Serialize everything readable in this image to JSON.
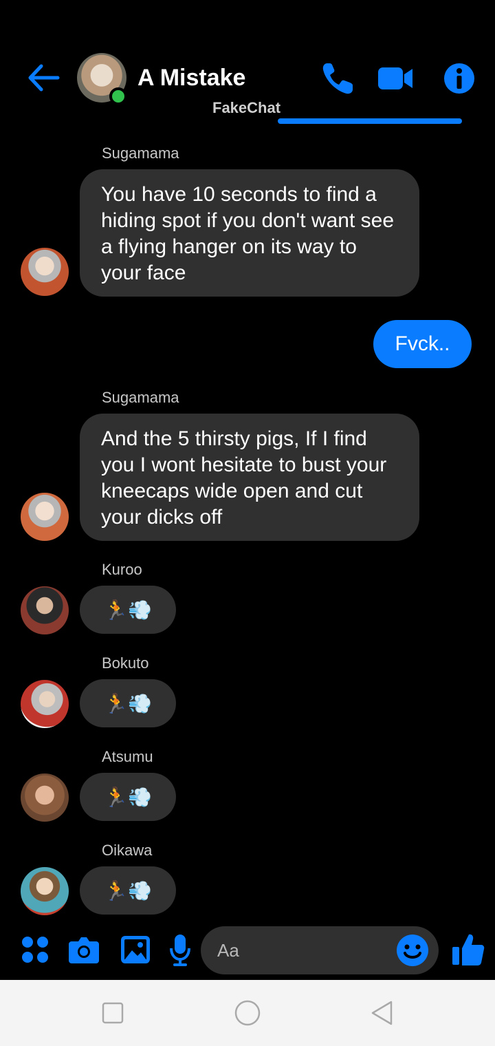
{
  "header": {
    "title": "A Mistake",
    "subtitle": "FakeChat"
  },
  "colors": {
    "accent": "#0a7cff",
    "bubble_in": "#303030",
    "online": "#31c24d",
    "background": "#000000"
  },
  "messages": [
    {
      "sender": "Sugamama",
      "text": "You have 10 seconds to find a hiding spot if you don't want see a flying hanger  on its way to your face"
    },
    {
      "sender": "me",
      "text": "Fvck.."
    },
    {
      "sender": "Sugamama",
      "text": "And the 5 thirsty pigs, If I find you I wont hesitate to bust your kneecaps wide open and cut your dicks off"
    },
    {
      "sender": "Kuroo",
      "text": "🏃💨"
    },
    {
      "sender": "Bokuto",
      "text": "🏃💨"
    },
    {
      "sender": "Atsumu",
      "text": "🏃💨"
    },
    {
      "sender": "Oikawa",
      "text": "🏃💨"
    }
  ],
  "composer": {
    "placeholder": "Aa"
  },
  "icons": [
    "back-arrow-icon",
    "phone-icon",
    "video-camera-icon",
    "info-icon",
    "apps-grid-icon",
    "camera-icon",
    "gallery-icon",
    "microphone-icon",
    "smiley-icon",
    "thumbs-up-icon",
    "recent-apps-icon",
    "home-icon",
    "nav-back-icon"
  ]
}
